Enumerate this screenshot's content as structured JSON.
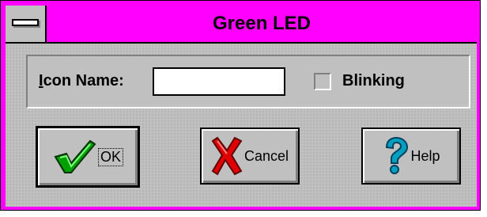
{
  "window": {
    "title": "Green LED"
  },
  "form": {
    "icon_name_label_prefix": "I",
    "icon_name_label_rest": "con Name:",
    "icon_name_value": "",
    "blinking_label": "Blinking",
    "blinking_checked": false
  },
  "buttons": {
    "ok_label": "OK",
    "cancel_label": "Cancel",
    "help_label": "Help"
  },
  "colors": {
    "title_bar": "#ff00ff",
    "face": "#c0c0c0",
    "check_green": "#00a000",
    "cancel_red": "#e00000",
    "help_teal": "#00a0c0"
  },
  "icons": {
    "system_menu": "system-menu-icon",
    "ok": "checkmark-icon",
    "cancel": "x-icon",
    "help": "question-mark-icon"
  }
}
